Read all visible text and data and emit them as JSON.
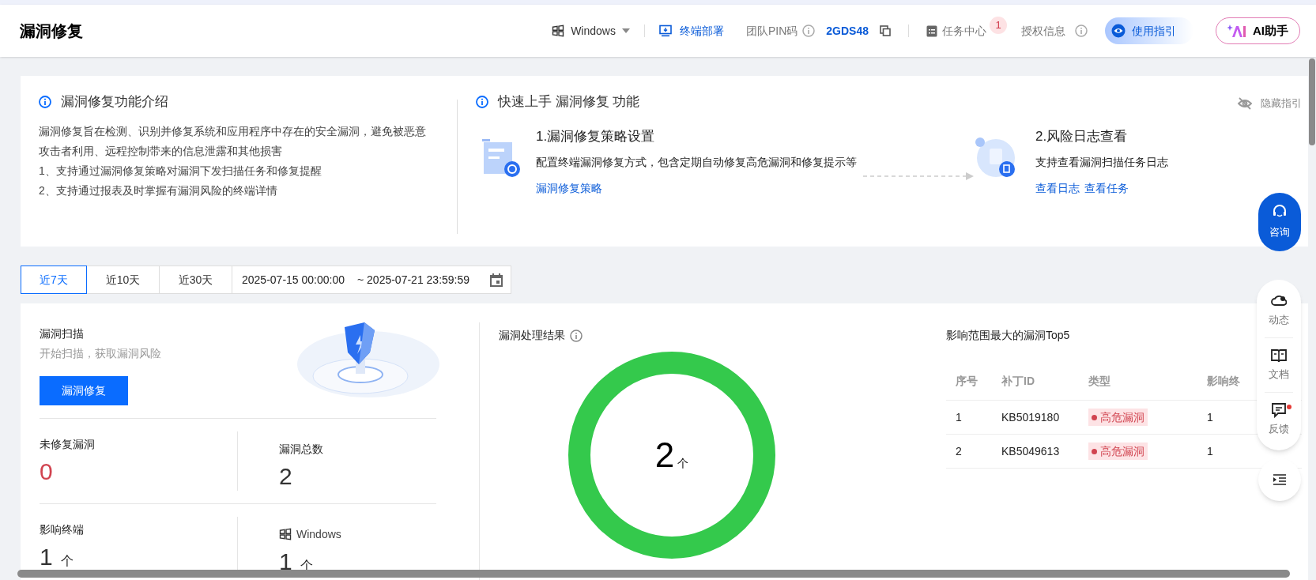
{
  "header": {
    "title": "漏洞修复",
    "os_selector": "Windows",
    "deploy_link": "终端部署",
    "pin_label": "团队PIN码",
    "pin_value": "2GDS48",
    "task_center": "任务中心",
    "task_badge": "1",
    "license_info": "授权信息",
    "guide_button": "使用指引",
    "ai_button": "AI助手"
  },
  "intro": {
    "title": "漏洞修复功能介绍",
    "lines": [
      "漏洞修复旨在检测、识别并修复系统和应用程序中存在的安全漏洞，避免被恶意攻击者利用、远程控制带来的信息泄露和其他损害",
      "1、支持通过漏洞修复策略对漏洞下发扫描任务和修复提醒",
      "2、支持通过报表及时掌握有漏洞风险的终端详情"
    ]
  },
  "quick_start": {
    "title": "快速上手 漏洞修复 功能",
    "hide_guide": "隐藏指引",
    "steps": [
      {
        "title": "1.漏洞修复策略设置",
        "desc": "配置终端漏洞修复方式，包含定期自动修复高危漏洞和修复提示等",
        "links": [
          "漏洞修复策略"
        ]
      },
      {
        "title": "2.风险日志查看",
        "desc": "支持查看漏洞扫描任务日志",
        "links": [
          "查看日志",
          "查看任务"
        ]
      }
    ]
  },
  "date_filter": {
    "ranges": [
      {
        "label": "近7天",
        "selected": true
      },
      {
        "label": "近10天",
        "selected": false
      },
      {
        "label": "近30天",
        "selected": false
      }
    ],
    "start": "2025-07-15 00:00:00",
    "end": "~ 2025-07-21 23:59:59"
  },
  "scan": {
    "title": "漏洞扫描",
    "subtitle": "开始扫描，获取漏洞风险",
    "button": "漏洞修复"
  },
  "stats": [
    {
      "kind": "metric",
      "label": "未修复漏洞",
      "value": "0",
      "alert": true
    },
    {
      "kind": "metric",
      "label": "漏洞总数",
      "value": "2",
      "alert": false
    },
    {
      "kind": "metric",
      "label": "影响终端",
      "value": "1",
      "unit": "个",
      "alert": false
    },
    {
      "kind": "platform",
      "label": "Windows",
      "value": "1",
      "unit": "个",
      "alert": false
    }
  ],
  "result": {
    "title": "漏洞处理结果",
    "total": "2",
    "unit": "个"
  },
  "top5": {
    "title": "影响范围最大的漏洞Top5",
    "columns": [
      "序号",
      "补丁ID",
      "类型",
      "影响终"
    ],
    "rows": [
      {
        "cells": [
          "1",
          "KB5019180",
          "高危漏洞",
          "1"
        ]
      },
      {
        "cells": [
          "2",
          "KB5049613",
          "高危漏洞",
          "1"
        ]
      }
    ]
  },
  "float_panel": {
    "consult": "咨询",
    "items": [
      {
        "label": "动态",
        "dot": false
      },
      {
        "label": "文档",
        "dot": false
      },
      {
        "label": "反馈",
        "dot": true
      }
    ]
  }
}
